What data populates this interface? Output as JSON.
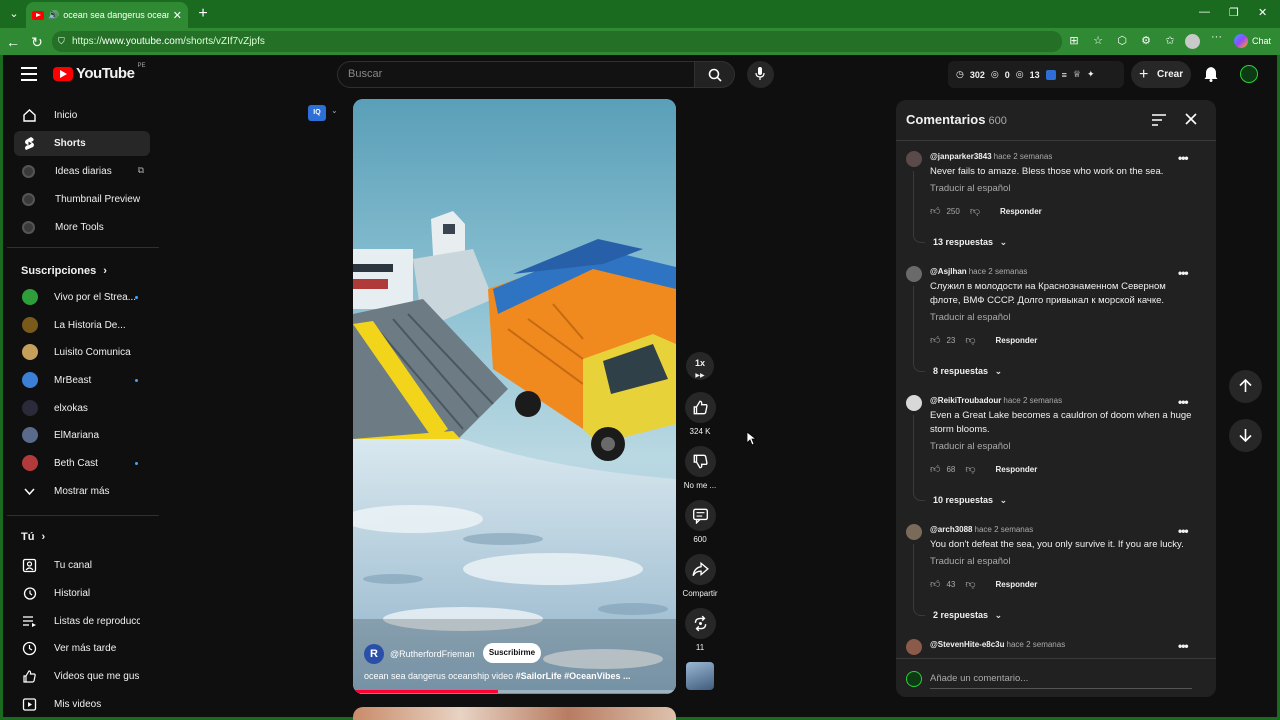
{
  "browser": {
    "tab_title": "ocean sea dangerus oceanship",
    "url_prefix": "https://",
    "url_host": "www.youtube.com",
    "url_path": "/shorts/vZIf7vZjpfs",
    "chat_label": "Chat"
  },
  "header": {
    "logo_text": "YouTube",
    "country_code": "PE",
    "search_placeholder": "Buscar",
    "stats": [
      "302",
      "0",
      "13"
    ],
    "create_label": "Crear"
  },
  "sidebar": {
    "main": [
      {
        "label": "Inicio",
        "icon": "home-icon"
      },
      {
        "label": "Shorts",
        "icon": "shorts-icon",
        "active": true
      },
      {
        "label": "Ideas diarias",
        "icon": "tool-icon",
        "external": true
      },
      {
        "label": "Thumbnail Preview",
        "icon": "tool-icon"
      },
      {
        "label": "More Tools",
        "icon": "tool-icon"
      }
    ],
    "subs_heading": "Suscripciones",
    "subscriptions": [
      {
        "label": "Vivo por el Strea...",
        "color": "#2e9e3a",
        "dot": true
      },
      {
        "label": "La Historia De...",
        "color": "#7a5a1a",
        "dot": false
      },
      {
        "label": "Luisito Comunica",
        "color": "#c4a05a",
        "dot": false
      },
      {
        "label": "MrBeast",
        "color": "#3b7fd6",
        "dot": true
      },
      {
        "label": "elxokas",
        "color": "#2a2a3a",
        "dot": false
      },
      {
        "label": "ElMariana",
        "color": "#5a6a8a",
        "dot": false
      },
      {
        "label": "Beth Cast",
        "color": "#b23a3a",
        "dot": true
      }
    ],
    "show_more": "Mostrar más",
    "you_heading": "Tú",
    "you_items": [
      {
        "label": "Tu canal",
        "icon": "channel-icon"
      },
      {
        "label": "Historial",
        "icon": "history-icon"
      },
      {
        "label": "Listas de reproducc...",
        "icon": "playlist-icon"
      },
      {
        "label": "Ver más tarde",
        "icon": "clock-icon"
      },
      {
        "label": "Videos que me gus...",
        "icon": "like-icon"
      },
      {
        "label": "Mis videos",
        "icon": "video-icon"
      }
    ]
  },
  "short": {
    "iq_badge": "IQ",
    "channel_initial": "R",
    "channel": "@RutherfordFrieman",
    "subscribe": "Suscribirme",
    "caption_text": "ocean sea dangerus oceanship video ",
    "caption_tags": "#SailorLife #OceanVibes ...",
    "progress_fraction": 0.45,
    "speed": "1x",
    "likes": "324 K",
    "dislike_label": "No me ...",
    "comments_count": "600",
    "share_label": "Compartir",
    "remix_count": "11"
  },
  "comments": {
    "title": "Comentarios",
    "count": "600",
    "add_placeholder": "Añade un comentario...",
    "items": [
      {
        "user": "@janparker3843",
        "when": "hace 2 semanas",
        "text": "Never fails to amaze. Bless those who work on the sea.",
        "translate": "Traducir al español",
        "likes": "250",
        "reply": "Responder",
        "replies": "13 respuestas",
        "avatar": "#5a4a4a"
      },
      {
        "user": "@Asjlhan",
        "when": "hace 2 semanas",
        "text": "Служил в молодости на Краснознаменном Северном флоте, ВМФ СССР. Долго привыкал к морской качке.",
        "translate": "Traducir al español",
        "likes": "23",
        "reply": "Responder",
        "replies": "8 respuestas",
        "avatar": "#6a6a6a"
      },
      {
        "user": "@ReikiTroubadour",
        "when": "hace 2 semanas",
        "text": "Even a Great Lake becomes a cauldron of doom when a huge storm blooms.",
        "translate": "Traducir al español",
        "likes": "68",
        "reply": "Responder",
        "replies": "10 respuestas",
        "avatar": "#d8d8d8"
      },
      {
        "user": "@arch3088",
        "when": "hace 2 semanas",
        "text": "You don't defeat the sea, you only survive it. If you are lucky.",
        "translate": "Traducir al español",
        "likes": "43",
        "reply": "Responder",
        "replies": "2 respuestas",
        "avatar": "#7a6a5a"
      },
      {
        "user": "@StevenHite-e8c3u",
        "when": "hace 2 semanas",
        "avatar": "#8a5a4a"
      }
    ]
  }
}
